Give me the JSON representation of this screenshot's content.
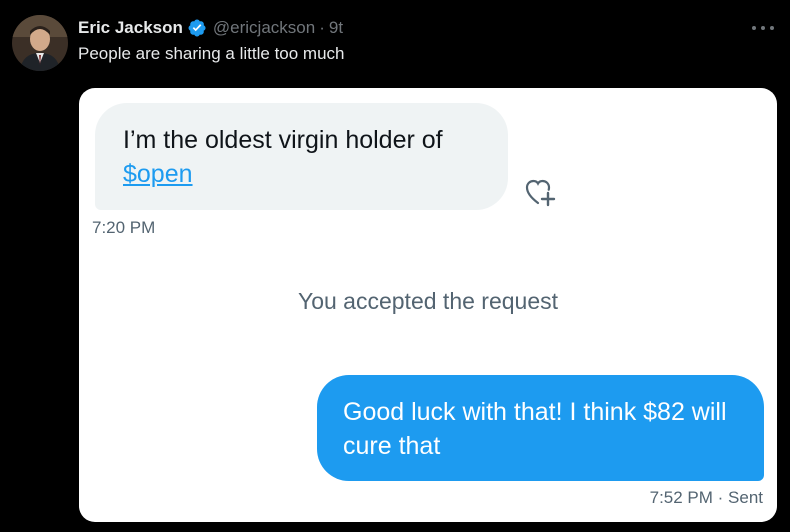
{
  "tweet": {
    "author_name": "Eric Jackson",
    "handle": "@ericjackson",
    "separator": "·",
    "time": "9t",
    "text": "People are sharing a little too much"
  },
  "dm": {
    "incoming": {
      "text": "I’m the oldest virgin holder of",
      "link": "$open",
      "timestamp": "7:20 PM"
    },
    "system_message": "You accepted the request",
    "outgoing": {
      "text": "Good luck with that! I think $82 will cure that",
      "timestamp": "7:52 PM · Sent"
    }
  },
  "colors": {
    "background": "#000000",
    "accent": "#1d9bf0",
    "bubble_incoming": "#eff3f4",
    "muted": "#71767b"
  },
  "icons": {
    "verified": "verified-badge-icon",
    "more": "more-options-icon",
    "react": "add-reaction-icon"
  }
}
